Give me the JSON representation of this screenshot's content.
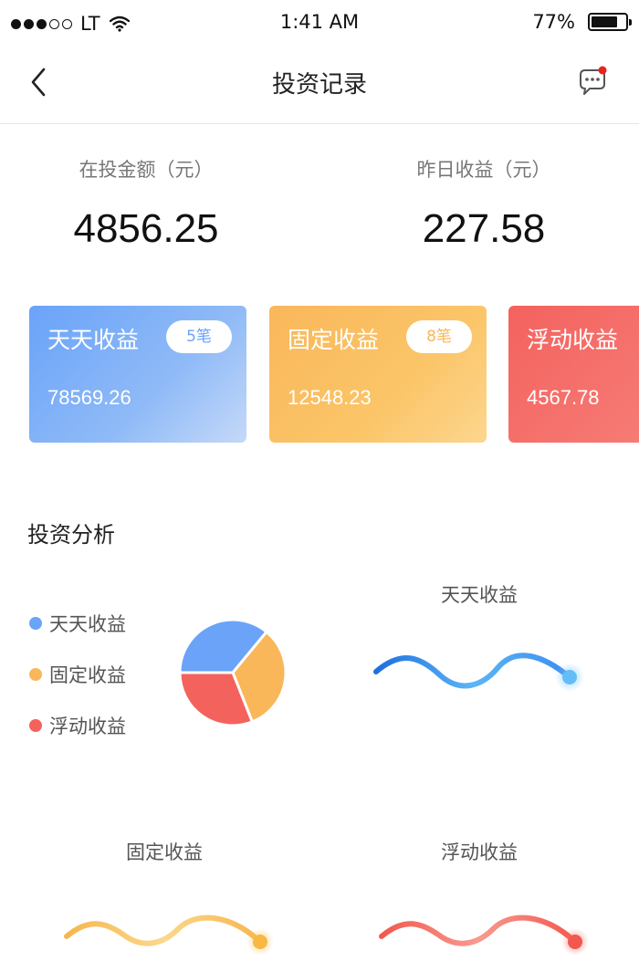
{
  "status_bar": {
    "signal_dots": [
      true,
      true,
      true,
      false,
      false
    ],
    "carrier": "LT",
    "time": "1:41 AM",
    "battery_percent": "77%",
    "battery_level": 0.77
  },
  "nav": {
    "title": "投资记录",
    "back_icon": "chevron-left-icon",
    "message_icon": "chat-bubble-icon",
    "message_badge_color": "#e8231f"
  },
  "summary": {
    "invested": {
      "label": "在投金额（元）",
      "value": "4856.25"
    },
    "yesterday": {
      "label": "昨日收益（元）",
      "value": "227.58"
    }
  },
  "cards": [
    {
      "title": "天天收益",
      "badge": "5笔",
      "value": "78569.26",
      "color": "#6aa3f8"
    },
    {
      "title": "固定收益",
      "badge": "8笔",
      "value": "12548.23",
      "color": "#f9b75a"
    },
    {
      "title": "浮动收益",
      "badge": "",
      "value": "4567.78",
      "color": "#f4625e"
    }
  ],
  "analysis": {
    "title": "投资分析",
    "legend": [
      {
        "label": "天天收益",
        "color": "#6aa3f8"
      },
      {
        "label": "固定收益",
        "color": "#f9b75a"
      },
      {
        "label": "浮动收益",
        "color": "#f4625e"
      }
    ],
    "pie_shares": [
      0.36,
      0.33,
      0.31
    ],
    "trend_titles": [
      "天天收益",
      "固定收益",
      "浮动收益"
    ]
  }
}
